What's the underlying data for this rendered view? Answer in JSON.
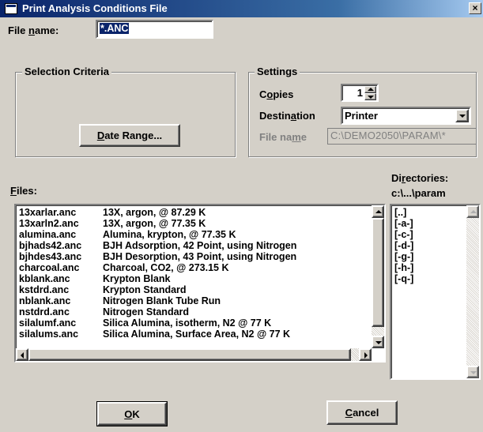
{
  "window": {
    "title": "Print Analysis Conditions File",
    "close_glyph": "×"
  },
  "file_name": {
    "label_pre": "File ",
    "label_u": "n",
    "label_post": "ame:",
    "value": "*.ANC"
  },
  "selection": {
    "legend": "Selection Criteria",
    "date_button": {
      "u": "D",
      "rest": "ate Range..."
    }
  },
  "settings": {
    "legend": "Settings",
    "copies": {
      "pre": "C",
      "u": "o",
      "post": "pies",
      "value": "1"
    },
    "destination": {
      "pre": "Destin",
      "u": "a",
      "post": "tion",
      "value": "Printer"
    },
    "file_name": {
      "pre": "File na",
      "u": "m",
      "post": "e",
      "value": "C:\\DEMO2050\\PARAM\\*"
    }
  },
  "files": {
    "label_u": "F",
    "label_rest": "iles:",
    "rows": [
      {
        "name": "13xarlar.anc",
        "desc": "13X, argon, @ 87.29 K"
      },
      {
        "name": "13xarln2.anc",
        "desc": "13X, argon, @ 77.35 K"
      },
      {
        "name": "alumina.anc",
        "desc": "Alumina, krypton, @ 77.35 K"
      },
      {
        "name": "bjhads42.anc",
        "desc": "BJH Adsorption, 42 Point, using Nitrogen"
      },
      {
        "name": "bjhdes43.anc",
        "desc": "BJH Desorption, 43 Point, using Nitrogen"
      },
      {
        "name": "charcoal.anc",
        "desc": "Charcoal, CO2, @ 273.15 K"
      },
      {
        "name": "kblank.anc",
        "desc": "Krypton Blank"
      },
      {
        "name": "kstdrd.anc",
        "desc": "Krypton Standard"
      },
      {
        "name": "nblank.anc",
        "desc": "Nitrogen Blank Tube Run"
      },
      {
        "name": "nstdrd.anc",
        "desc": "Nitrogen Standard"
      },
      {
        "name": "silalumf.anc",
        "desc": "Silica Alumina, isotherm, N2 @ 77 K"
      },
      {
        "name": "silalums.anc",
        "desc": "Silica Alumina, Surface Area, N2 @ 77 K"
      }
    ]
  },
  "directories": {
    "label_pre": "Di",
    "label_u": "r",
    "label_post": "ectories:",
    "path": "c:\\...\\param",
    "items": [
      "[..]",
      "[-a-]",
      "[-c-]",
      "[-d-]",
      "[-g-]",
      "[-h-]",
      "[-q-]"
    ]
  },
  "buttons": {
    "ok": {
      "u": "O",
      "rest": "K"
    },
    "cancel": {
      "u": "C",
      "rest": "ancel"
    }
  }
}
